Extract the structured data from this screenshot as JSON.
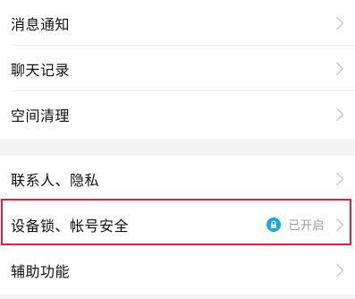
{
  "settings": {
    "group_one": [
      {
        "label": "消息通知"
      },
      {
        "label": "聊天记录"
      },
      {
        "label": "空间清理"
      }
    ],
    "group_two": [
      {
        "label": "联系人、隐私"
      },
      {
        "label": "设备锁、帐号安全",
        "status": "已开启",
        "status_icon": "lock-icon"
      },
      {
        "label": "辅助功能"
      }
    ]
  },
  "colors": {
    "accent": "#12a7f0",
    "highlight_border": "#e02040",
    "status_text": "#9a9a9a"
  }
}
